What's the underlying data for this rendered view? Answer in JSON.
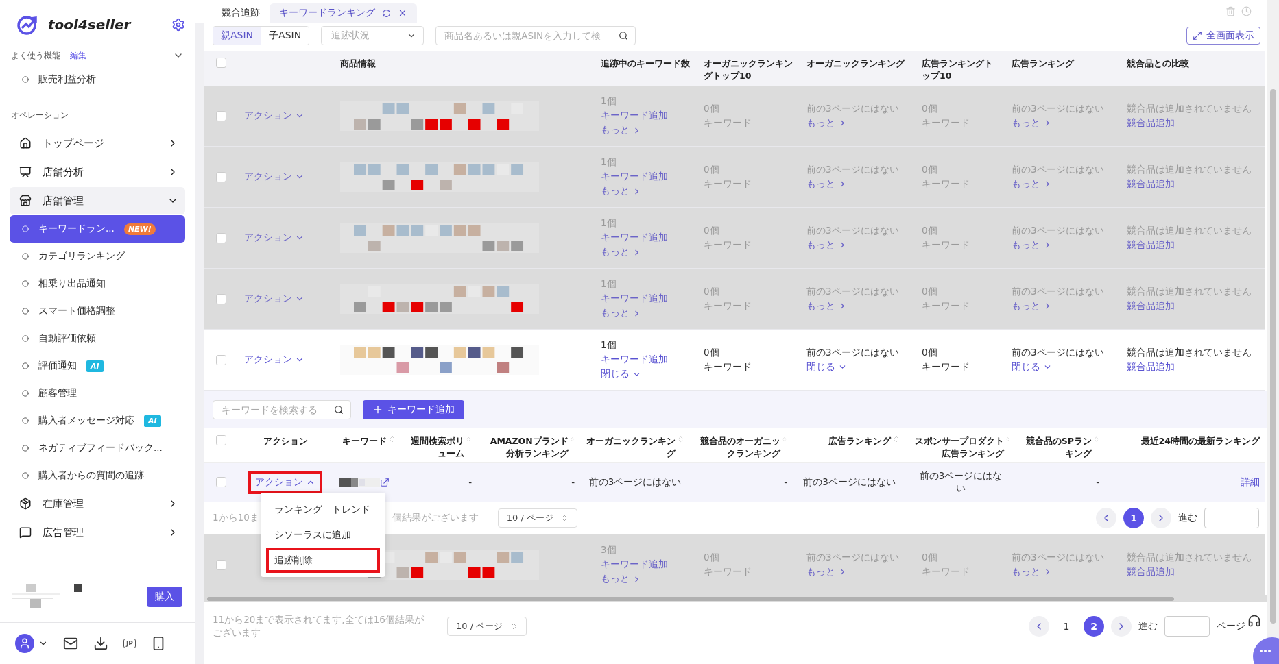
{
  "sidebar": {
    "brand": "tool4seller",
    "favorites": {
      "label": "よく使う機能",
      "edit": "編集",
      "expanded": true,
      "items": [
        {
          "label": "販売利益分析",
          "selected": false
        }
      ]
    },
    "section_label": "オペレーション",
    "nav": [
      {
        "label": "トップページ",
        "expanded": false
      },
      {
        "label": "店舗分析",
        "expanded": false
      },
      {
        "label": "店舗管理",
        "expanded": true,
        "children": [
          {
            "label": "キーワードラン...",
            "selected": true,
            "badge": {
              "kind": "new",
              "text": "NEW!"
            }
          },
          {
            "label": "カテゴリランキング",
            "selected": false
          },
          {
            "label": "相乗り出品通知",
            "selected": false
          },
          {
            "label": "スマート価格調整",
            "selected": false
          },
          {
            "label": "自動評価依頼",
            "selected": false
          },
          {
            "label": "評価通知",
            "selected": false,
            "badge": {
              "kind": "ai",
              "text": "AI"
            }
          },
          {
            "label": "顧客管理",
            "selected": false
          },
          {
            "label": "購入者メッセージ対応",
            "selected": false,
            "badge": {
              "kind": "ai",
              "text": "AI"
            }
          },
          {
            "label": "ネガティブフィードバック...",
            "selected": false
          },
          {
            "label": "購入者からの質問の追跡",
            "selected": false
          }
        ]
      },
      {
        "label": "在庫管理",
        "expanded": false
      },
      {
        "label": "広告管理",
        "expanded": false
      }
    ],
    "buy_button": "購入",
    "language": "JP"
  },
  "tabs": [
    {
      "label": "競合追跡",
      "selected": false
    },
    {
      "label": "キーワードランキング",
      "selected": true
    }
  ],
  "asin_toggle": [
    {
      "label": "親ASIN",
      "selected": true
    },
    {
      "label": "子ASIN",
      "selected": false
    }
  ],
  "status_filter": {
    "placeholder": "追跡状況"
  },
  "search": {
    "placeholder": "商品名あるいは親ASINを入力して検"
  },
  "fullscreen_button": "全画面表示",
  "table": {
    "header_checked": false,
    "columns": [
      "商品情報",
      "追跡中のキーワード数",
      "オーガニックランキングトップ10",
      "オーガニックランキング",
      "広告ランキングトップ10",
      "広告ランキング",
      "競合品との比較"
    ],
    "rows": [
      {
        "checked": false,
        "dimmed": true,
        "expanded": false,
        "action": "アクション",
        "keyword_count": "1個",
        "add_keyword": "キーワード追加",
        "toggle": "もっと",
        "organic_top10": "0個",
        "organic_top10_unit": "キーワード",
        "organic_rank": "前の3ページにはない",
        "organic_toggle": "もっと",
        "ad_top10": "0個",
        "ad_top10_unit": "キーワード",
        "ad_rank": "前の3ページにはない",
        "ad_toggle": "もっと",
        "compare": "競合品は追加されていません",
        "compare_link": "競合品追加"
      },
      {
        "checked": false,
        "dimmed": true,
        "expanded": false,
        "action": "アクション",
        "keyword_count": "1個",
        "add_keyword": "キーワード追加",
        "toggle": "もっと",
        "organic_top10": "0個",
        "organic_top10_unit": "キーワード",
        "organic_rank": "前の3ページにはない",
        "organic_toggle": "もっと",
        "ad_top10": "0個",
        "ad_top10_unit": "キーワード",
        "ad_rank": "前の3ページにはない",
        "ad_toggle": "もっと",
        "compare": "競合品は追加されていません",
        "compare_link": "競合品追加"
      },
      {
        "checked": false,
        "dimmed": true,
        "expanded": false,
        "action": "アクション",
        "keyword_count": "1個",
        "add_keyword": "キーワード追加",
        "toggle": "もっと",
        "organic_top10": "0個",
        "organic_top10_unit": "キーワード",
        "organic_rank": "前の3ページにはない",
        "organic_toggle": "もっと",
        "ad_top10": "0個",
        "ad_top10_unit": "キーワード",
        "ad_rank": "前の3ページにはない",
        "ad_toggle": "もっと",
        "compare": "競合品は追加されていません",
        "compare_link": "競合品追加"
      },
      {
        "checked": false,
        "dimmed": true,
        "expanded": false,
        "action": "アクション",
        "keyword_count": "1個",
        "add_keyword": "キーワード追加",
        "toggle": "もっと",
        "organic_top10": "0個",
        "organic_top10_unit": "キーワード",
        "organic_rank": "前の3ページにはない",
        "organic_toggle": "もっと",
        "ad_top10": "0個",
        "ad_top10_unit": "キーワード",
        "ad_rank": "前の3ページにはない",
        "ad_toggle": "もっと",
        "compare": "競合品は追加されていません",
        "compare_link": "競合品追加"
      },
      {
        "checked": false,
        "dimmed": false,
        "expanded": true,
        "action": "アクション",
        "keyword_count": "1個",
        "add_keyword": "キーワード追加",
        "toggle": "閉じる",
        "organic_top10": "0個",
        "organic_top10_unit": "キーワード",
        "organic_rank": "前の3ページにはない",
        "organic_toggle": "閉じる",
        "ad_top10": "0個",
        "ad_top10_unit": "キーワード",
        "ad_rank": "前の3ページにはない",
        "ad_toggle": "閉じる",
        "compare": "競合品は追加されていません",
        "compare_link": "競合品追加"
      },
      {
        "checked": false,
        "dimmed": true,
        "expanded": false,
        "keyword_count": "3個",
        "add_keyword": "キーワード追加",
        "toggle": "もっと",
        "organic_top10": "0個",
        "organic_top10_unit": "キーワード",
        "organic_rank": "前の3ページにはない",
        "organic_toggle": "もっと",
        "ad_top10": "0個",
        "ad_top10_unit": "キーワード",
        "ad_rank": "前の3ページにはない",
        "ad_toggle": "もっと",
        "compare": "競合品は追加されていません",
        "compare_link": "競合品追加"
      }
    ],
    "detail": {
      "search": {
        "placeholder": "キーワードを検索する"
      },
      "add_button": "キーワード追加",
      "header_checked": false,
      "columns": [
        {
          "label": "アクション",
          "sortable": false
        },
        {
          "label": "キーワード",
          "sortable": true
        },
        {
          "label": "週間検索ボリューム",
          "sortable": true
        },
        {
          "label": "AMAZONブランド分析ランキング",
          "sortable": true
        },
        {
          "label": "オーガニックランキング",
          "sortable": true
        },
        {
          "label": "競合品のオーガニックランキング",
          "sortable": true
        },
        {
          "label": "広告ランキング",
          "sortable": true
        },
        {
          "label": "スポンサープロダクト広告ランキング",
          "sortable": true
        },
        {
          "label": "競合品のSPランキング",
          "sortable": true
        },
        {
          "label": "最近24時間の最新ランキング",
          "sortable": false
        }
      ],
      "rows": [
        {
          "checked": false,
          "action": "アクション",
          "menu_open": true,
          "annotated": true,
          "weekly": "-",
          "amazon": "-",
          "organic": "前の3ページにはない",
          "competitor_organic": "-",
          "ad_rank": "前の3ページにはない",
          "sponsor": "前の3ページにはない",
          "competitor_sp": "-",
          "detail_link": "詳細"
        }
      ],
      "menu": [
        {
          "label": "ランキング　トレンド",
          "annotated": false
        },
        {
          "label": "シソーラスに追加",
          "annotated": false
        },
        {
          "label": "追跡削除",
          "annotated": true
        }
      ],
      "summary_start": "1から10ま",
      "summary_end": "個結果がございます",
      "page_size": "10 / ページ",
      "pages": [
        {
          "label": "1",
          "selected": true
        }
      ],
      "goto": "進む"
    }
  },
  "footer": {
    "summary": "11から20まで表示されてます,全ては16個結果がございます",
    "page_size": "10 / ページ",
    "pages": [
      {
        "label": "1",
        "selected": false
      },
      {
        "label": "2",
        "selected": true
      }
    ],
    "goto": "進む",
    "page_suffix": "ページ"
  }
}
